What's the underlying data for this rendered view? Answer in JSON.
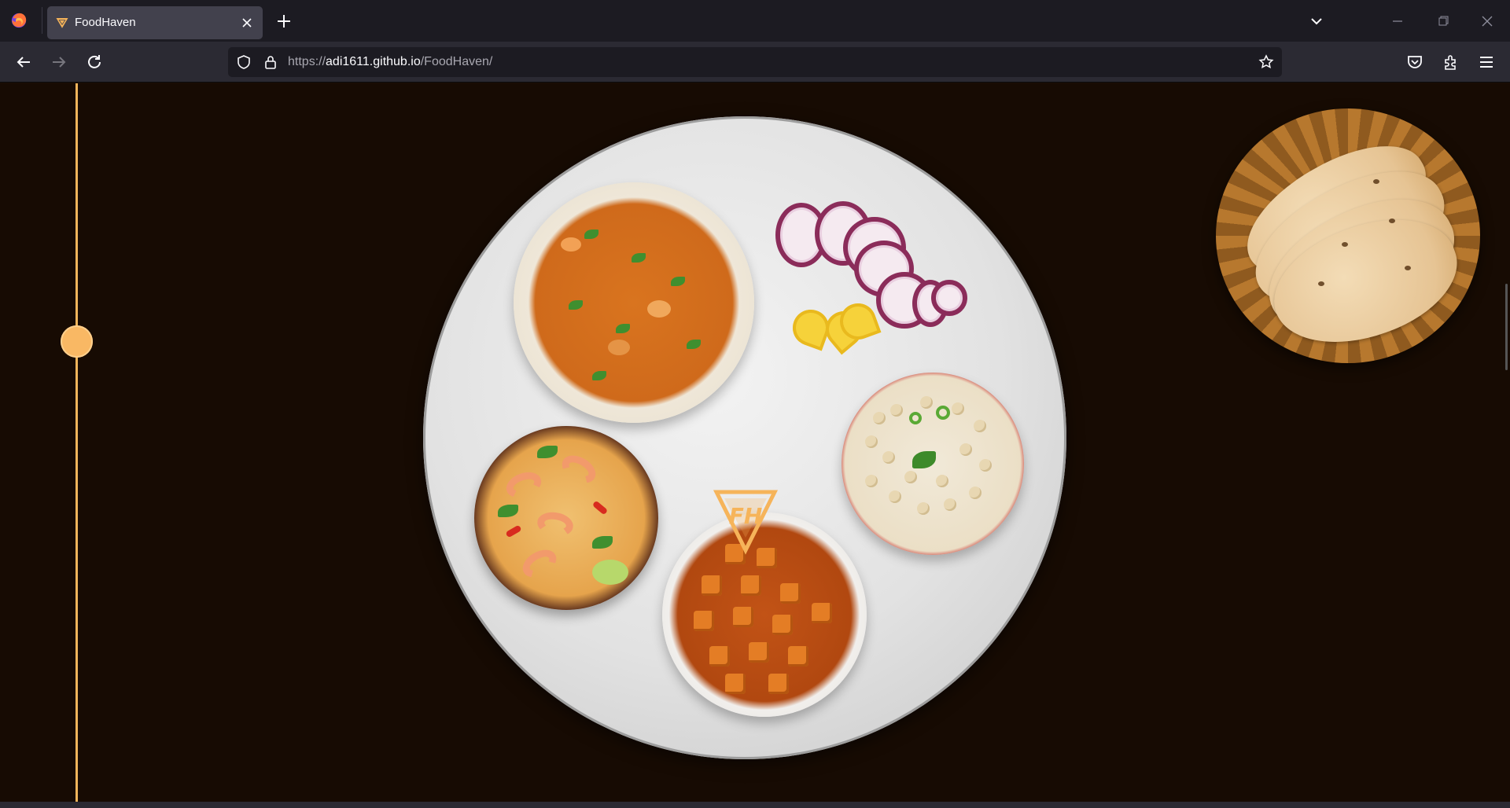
{
  "browser": {
    "tab": {
      "title": "FoodHaven"
    },
    "url": {
      "scheme": "https://",
      "host": "adi1611.github.io",
      "path": "/FoodHaven/"
    }
  },
  "colors": {
    "page_bg": "#170b03",
    "timeline_accent": "#f0b45a",
    "brand_gold": "#f6b45a"
  },
  "icons": {
    "firefox": "firefox-icon",
    "tab_favicon": "foodhaven-logo-icon",
    "close": "close-icon",
    "new_tab": "plus-icon",
    "list_tabs": "chevron-down-icon",
    "back": "back-arrow-icon",
    "forward": "forward-arrow-icon",
    "reload": "reload-icon",
    "shield": "shield-icon",
    "lock": "lock-icon",
    "bookmark": "star-icon",
    "pocket": "pocket-icon",
    "extensions": "puzzle-icon",
    "menu": "hamburger-menu-icon"
  },
  "page": {
    "logo_text": "FH",
    "dishes": [
      "biryani",
      "onion-and-lemon",
      "shrimp-curry",
      "paneer-curry",
      "boondi-raita",
      "roti-basket"
    ]
  }
}
